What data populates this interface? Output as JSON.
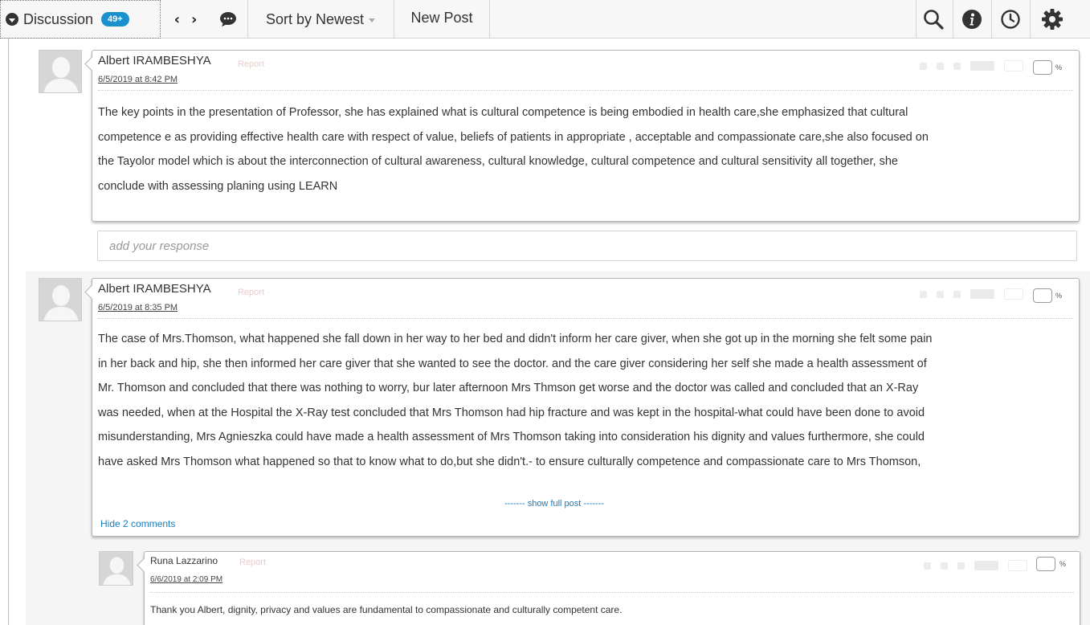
{
  "toolbar": {
    "discussion_label": "Discussion",
    "count_badge": "49+",
    "sort_label": "Sort by Newest",
    "new_post_label": "New Post",
    "icons": [
      "chevron-left-icon",
      "chevron-right-icon",
      "chat-icon",
      "search-icon",
      "info-icon",
      "clock-icon",
      "gear-icon"
    ]
  },
  "posts": [
    {
      "author": "Albert IRAMBESHYA",
      "report": "Report",
      "timestamp": "6/5/2019 at 8:42 PM",
      "percent": "%",
      "lines": [
        "The key points in the presentation of Professor, she has explained what is cultural competence is being embodied in health care,she emphasized that cultural",
        "competence e as providing effective health care with respect of value, beliefs of patients in appropriate , acceptable and compassionate care,she also focused on",
        "the Tayolor model which is about the interconnection of cultural awareness, cultural knowledge, cultural competence and cultural sensitivity all together, she",
        "conclude with assessing planing using LEARN"
      ],
      "response_placeholder": "add your response"
    },
    {
      "author": "Albert IRAMBESHYA",
      "report": "Report",
      "timestamp": "6/5/2019 at 8:35 PM",
      "percent": "%",
      "lines": [
        "The case of Mrs.Thomson, what happened she fall down in her way to her bed and didn't inform her care giver,  when she got up in the morning she felt some pain",
        "in her back and hip, she then informed her care giver that she wanted to see the doctor. and the care giver considering her self she made a health assessment of",
        "Mr. Thomson and concluded that there was nothing to worry, bur later afternoon Mrs Thmson get worse and the doctor was called and concluded that an X-Ray",
        "was needed, when at the Hospital the X-Ray test concluded that Mrs Thomson had hip fracture and was kept in the hospital-what could have been done to avoid",
        "misunderstanding, Mrs Agnieszka could have made a health assessment of Mrs Thomson taking into consideration his dignity and values furthermore, she could",
        "have asked Mrs Thomson what happened so that to know what to do,but she didn't.- to ensure culturally competence and compassionate care to Mrs Thomson,"
      ],
      "show_full": "------- show full post -------",
      "hide_comments": "Hide 2 comments"
    }
  ],
  "comment": {
    "author": "Runa Lazzarino",
    "report": "Report",
    "timestamp": "6/6/2019 at 2:09 PM",
    "percent": "%",
    "text": "Thank you Albert, dignity, privacy and values are fundamental to compassionate and culturally competent care."
  }
}
